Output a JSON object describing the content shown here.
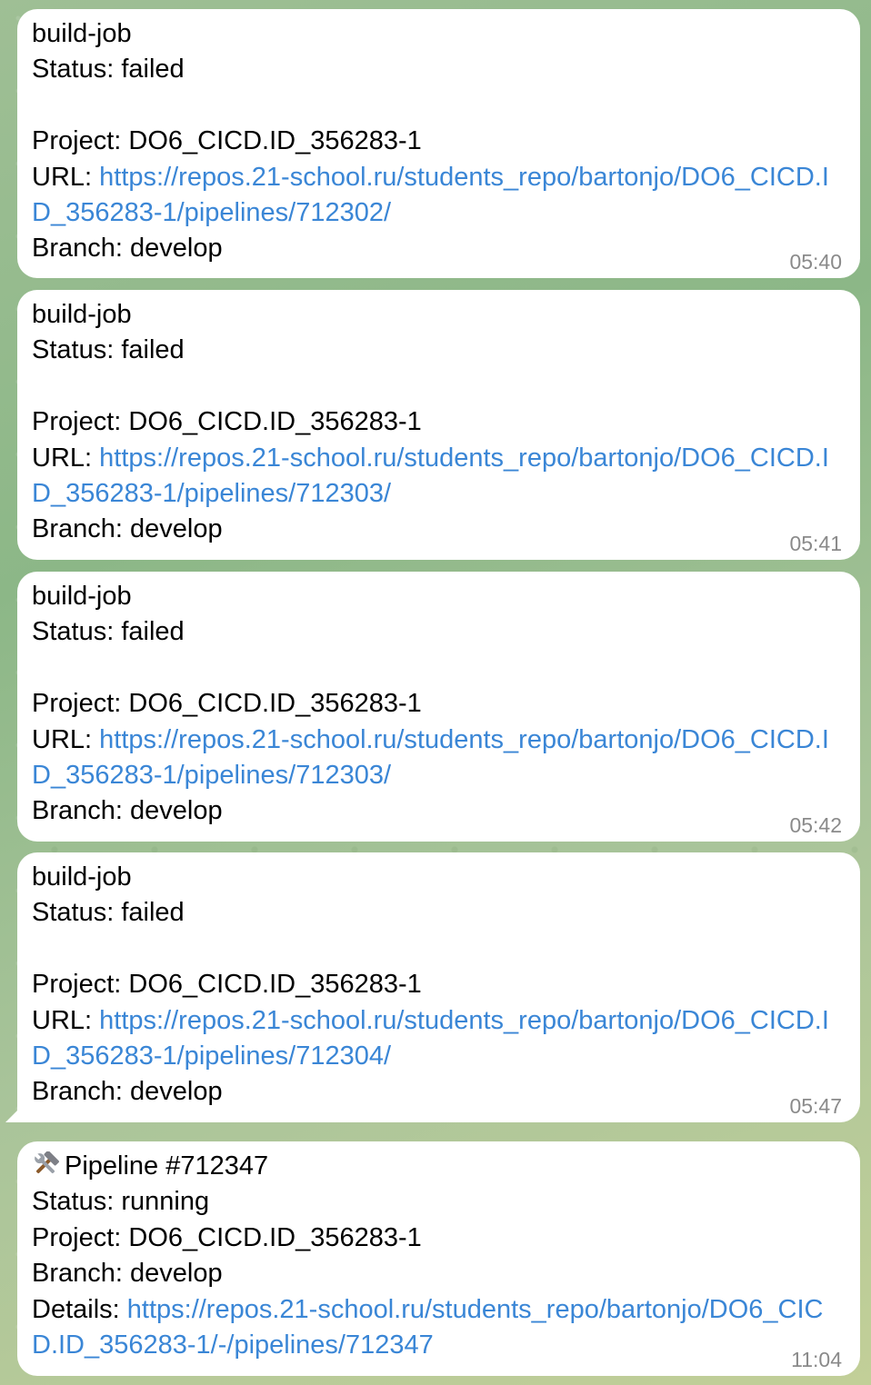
{
  "messages": [
    {
      "title": "build-job",
      "status": "Status: failed",
      "project": "Project: DO6_CICD.ID_356283-1",
      "url_label": "URL: ",
      "url": "https://repos.21-school.ru/students_repo/bartonjo/DO6_CICD.ID_356283-1/pipelines/712302/",
      "branch": "Branch: develop",
      "time": "05:40"
    },
    {
      "title": "build-job",
      "status": "Status: failed",
      "project": "Project: DO6_CICD.ID_356283-1",
      "url_label": "URL: ",
      "url": "https://repos.21-school.ru/students_repo/bartonjo/DO6_CICD.ID_356283-1/pipelines/712303/",
      "branch": "Branch: develop",
      "time": "05:41"
    },
    {
      "title": "build-job",
      "status": "Status: failed",
      "project": "Project: DO6_CICD.ID_356283-1",
      "url_label": "URL: ",
      "url": "https://repos.21-school.ru/students_repo/bartonjo/DO6_CICD.ID_356283-1/pipelines/712303/",
      "branch": "Branch: develop",
      "time": "05:42"
    },
    {
      "title": "build-job",
      "status": "Status: failed",
      "project": "Project: DO6_CICD.ID_356283-1",
      "url_label": "URL: ",
      "url": "https://repos.21-school.ru/students_repo/bartonjo/DO6_CICD.ID_356283-1/pipelines/712304/",
      "branch": "Branch: develop",
      "time": "05:47"
    },
    {
      "icon": "hammer-and-wrench-icon",
      "title": "Pipeline #712347",
      "status": "Status: running",
      "project": "Project: DO6_CICD.ID_356283-1",
      "branch": "Branch: develop",
      "details_label": "Details: ",
      "details_url": "https://repos.21-school.ru/students_repo/bartonjo/DO6_CICD.ID_356283-1/-/pipelines/712347",
      "time": "11:04"
    }
  ],
  "colors": {
    "link": "#3a86d6",
    "bubble": "#ffffff",
    "timestamp": "#8a8a8a"
  }
}
